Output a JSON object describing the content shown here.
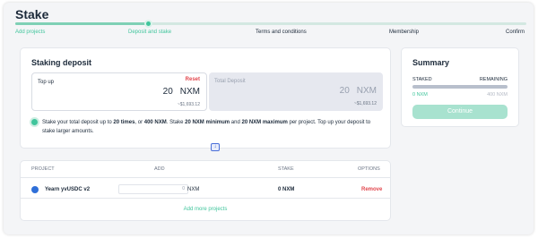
{
  "page": {
    "title": "Stake"
  },
  "steps": [
    {
      "label": "Add projects",
      "state": "done"
    },
    {
      "label": "Deposit and stake",
      "state": "current"
    },
    {
      "label": "Terms and conditions",
      "state": "todo"
    },
    {
      "label": "Membership",
      "state": "todo"
    },
    {
      "label": "Confirm",
      "state": "todo"
    }
  ],
  "progress": {
    "fraction": 0.26
  },
  "staking": {
    "title": "Staking deposit",
    "top_up": {
      "label": "Top up",
      "reset_label": "Reset",
      "amount": "20",
      "unit": "NXM",
      "fiat": "~$1,693.12"
    },
    "total_deposit": {
      "label": "Total Deposit",
      "amount": "20",
      "unit": "NXM",
      "fiat": "~$1,693.12"
    },
    "info": {
      "t1": "Stake your total deposit up to ",
      "b1": "20 times",
      "t2": ", or ",
      "b2": "400 NXM",
      "t3": ". Stake ",
      "b3": "20 NXM minimum",
      "t4": " and ",
      "b4": "20 NXM maximum",
      "t5": " per project. Top up your deposit to stake larger amounts."
    }
  },
  "table": {
    "columns": {
      "project": "PROJECT",
      "add": "ADD",
      "stake": "STAKE",
      "options": "OPTIONS"
    },
    "rows": [
      {
        "project": "Yearn yvUSDC v2",
        "add_value": "0",
        "add_unit": "NXM",
        "stake": "0 NXM",
        "option": "Remove"
      }
    ],
    "add_more": "Add more projects"
  },
  "summary": {
    "title": "Summary",
    "staked_label": "STAKED",
    "remaining_label": "REMAINING",
    "staked_value": "0 NXM",
    "remaining_value": "400 NXM",
    "continue_label": "Continue"
  },
  "colors": {
    "accent": "#40c59c",
    "danger": "#e2474e",
    "text": "#1c2a3a"
  },
  "icons": {
    "info": "info-dot-icon",
    "project": "yearn-logo-icon",
    "scroll": "arrow-down-icon"
  }
}
